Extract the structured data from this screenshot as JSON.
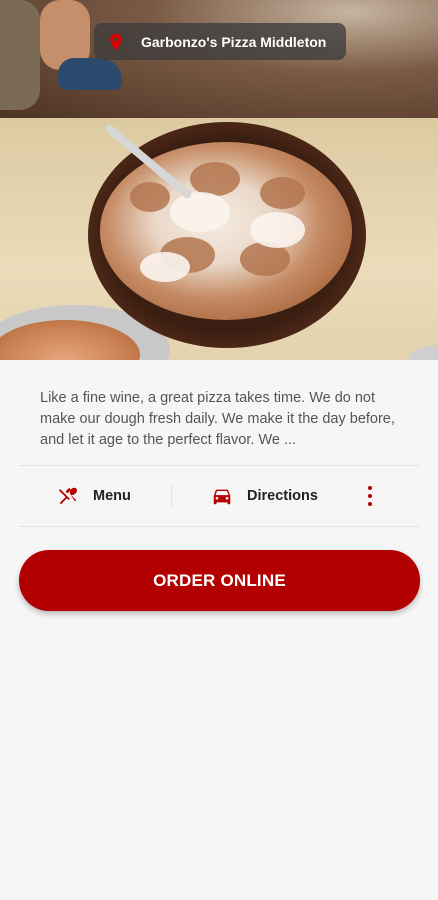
{
  "location": {
    "name": "Garbonzo's Pizza Middleton",
    "icon": "map-pin-icon"
  },
  "description": "Like a fine wine, a great pizza takes time. We do not make our dough fresh daily. We make it the day before, and let it age to the perfect flavor. We ...",
  "actions": {
    "menu_label": "Menu",
    "menu_icon": "fork-spoon-icon",
    "directions_label": "Directions",
    "directions_icon": "car-icon",
    "more_icon": "more-vertical-icon"
  },
  "order_button": {
    "label": "ORDER ONLINE"
  },
  "colors": {
    "accent": "#b30000",
    "chip_bg": "#3c3c3c",
    "background": "#f6f6f6"
  }
}
